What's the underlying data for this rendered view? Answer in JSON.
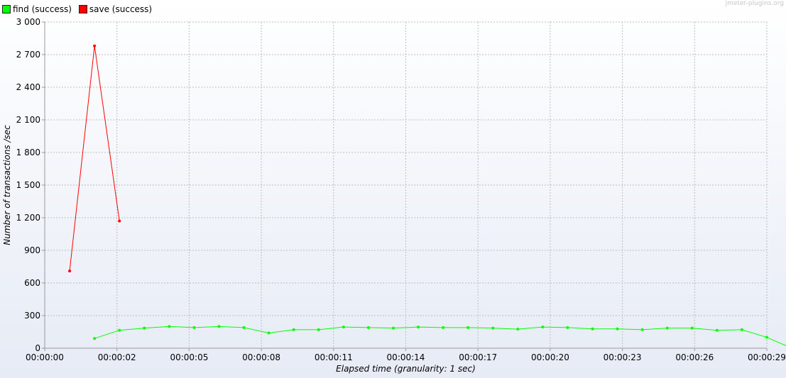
{
  "watermark": "jmeter-plugins.org",
  "legend": [
    {
      "label": "find (success)",
      "color": "#00ff00"
    },
    {
      "label": "save (success)",
      "color": "#ff0000"
    }
  ],
  "chart_data": {
    "type": "line",
    "xlabel": "Elapsed time (granularity: 1 sec)",
    "ylabel": "Number of transactions /sec",
    "xlim": [
      0,
      29
    ],
    "ylim": [
      0,
      3000
    ],
    "grid": true,
    "legend_position": "top-left",
    "y_ticks": [
      {
        "value": 0,
        "label": "0"
      },
      {
        "value": 300,
        "label": "300"
      },
      {
        "value": 600,
        "label": "600"
      },
      {
        "value": 900,
        "label": "900"
      },
      {
        "value": 1200,
        "label": "1 200"
      },
      {
        "value": 1500,
        "label": "1 500"
      },
      {
        "value": 1800,
        "label": "1 800"
      },
      {
        "value": 2100,
        "label": "2 100"
      },
      {
        "value": 2400,
        "label": "2 400"
      },
      {
        "value": 2700,
        "label": "2 700"
      },
      {
        "value": 3000,
        "label": "3 000"
      }
    ],
    "x_ticks": [
      {
        "value": 0,
        "label": "00:00:00"
      },
      {
        "value": 2.9,
        "label": "00:00:02"
      },
      {
        "value": 5.8,
        "label": "00:00:05"
      },
      {
        "value": 8.7,
        "label": "00:00:08"
      },
      {
        "value": 11.6,
        "label": "00:00:11"
      },
      {
        "value": 14.5,
        "label": "00:00:14"
      },
      {
        "value": 17.4,
        "label": "00:00:17"
      },
      {
        "value": 20.3,
        "label": "00:00:20"
      },
      {
        "value": 23.2,
        "label": "00:00:23"
      },
      {
        "value": 26.1,
        "label": "00:00:26"
      },
      {
        "value": 29,
        "label": "00:00:29"
      }
    ],
    "series": [
      {
        "name": "find (success)",
        "color": "#00ff00",
        "x": [
          2,
          3,
          4,
          5,
          6,
          7,
          8,
          9,
          10,
          11,
          12,
          13,
          14,
          15,
          16,
          17,
          18,
          19,
          20,
          21,
          22,
          23,
          24,
          25,
          26,
          27,
          28,
          29,
          30
        ],
        "y": [
          90,
          165,
          185,
          200,
          190,
          200,
          190,
          140,
          170,
          170,
          195,
          190,
          185,
          195,
          190,
          190,
          185,
          175,
          195,
          190,
          178,
          178,
          170,
          185,
          185,
          165,
          170,
          100,
          0
        ]
      },
      {
        "name": "save (success)",
        "color": "#ff0000",
        "x": [
          1,
          2,
          3
        ],
        "y": [
          710,
          2780,
          1170
        ]
      }
    ]
  }
}
